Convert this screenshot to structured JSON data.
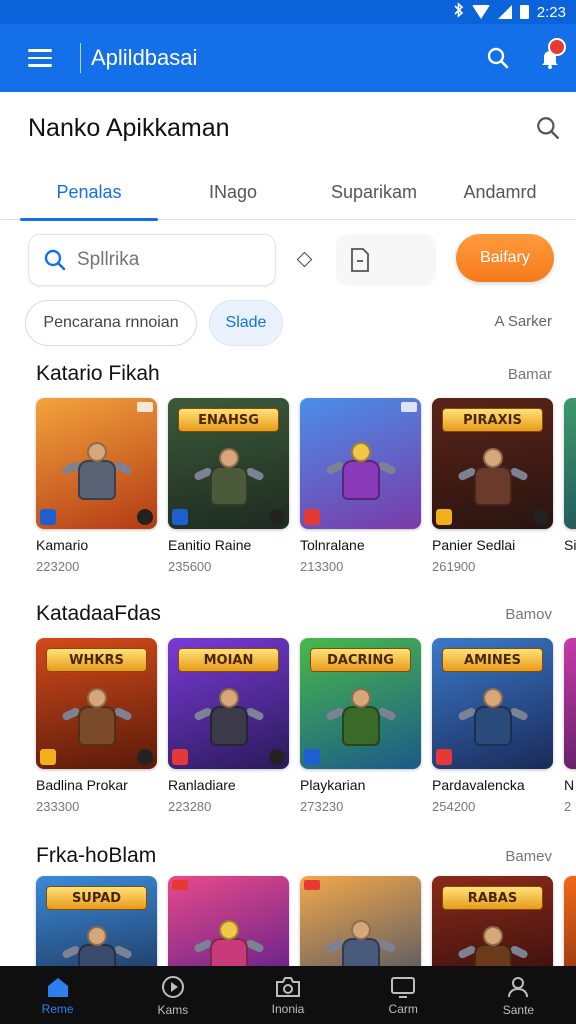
{
  "status_bar": {
    "time": "2:23"
  },
  "app_bar": {
    "title": "Aplildbasai"
  },
  "page": {
    "title": "Nanko Apikkaman"
  },
  "tabs": [
    {
      "label": "Penalas",
      "active": true
    },
    {
      "label": "INago",
      "active": false
    },
    {
      "label": "Suparikam",
      "active": false
    },
    {
      "label": "Andamrd",
      "active": false
    }
  ],
  "search": {
    "placeholder": "Spllrika"
  },
  "filter_button": {
    "label": "Baifary"
  },
  "chips": [
    {
      "label": "Pencarana rnnoian"
    },
    {
      "label": "Slade"
    }
  ],
  "sort_label": "A Sarker",
  "sections": [
    {
      "title": "Katario Fikah",
      "link": "Bamar",
      "items": [
        {
          "name": "Kamario",
          "count": "223200",
          "logo": ""
        },
        {
          "name": "Eanitio Rainе",
          "count": "235600",
          "logo": "ENAHSG"
        },
        {
          "name": "Tolnralane",
          "count": "213300",
          "logo": ""
        },
        {
          "name": "Panier Sedlai",
          "count": "261900",
          "logo": "PIRAXIS"
        },
        {
          "name": "Si",
          "count": "",
          "logo": ""
        }
      ]
    },
    {
      "title": "KatadaaFdas",
      "link": "Bamov",
      "items": [
        {
          "name": "Badlina Prokar",
          "count": "233300",
          "logo": "WHKRS"
        },
        {
          "name": "Ranladiare",
          "count": "223280",
          "logo": "MOIAN"
        },
        {
          "name": "Playkarian",
          "count": "273230",
          "logo": "DACRING"
        },
        {
          "name": "Pardavalencka",
          "count": "254200",
          "logo": "AMINES"
        },
        {
          "name": "N",
          "count": "2",
          "logo": ""
        }
      ]
    },
    {
      "title": "Frka-hoBlam",
      "link": "Bamev",
      "items": [
        {
          "name": "",
          "count": "",
          "logo": "SUPAD"
        },
        {
          "name": "",
          "count": "",
          "logo": ""
        },
        {
          "name": "",
          "count": "",
          "logo": ""
        },
        {
          "name": "",
          "count": "",
          "logo": "RABAS"
        },
        {
          "name": "",
          "count": "",
          "logo": ""
        }
      ]
    }
  ],
  "bottom_nav": [
    {
      "label": "Reme",
      "icon": "home-icon",
      "active": true
    },
    {
      "label": "Kams",
      "icon": "play-circle-icon",
      "active": false
    },
    {
      "label": "Inonia",
      "icon": "camera-icon",
      "active": false
    },
    {
      "label": "Carm",
      "icon": "monitor-icon",
      "active": false
    },
    {
      "label": "Sante",
      "icon": "profile-icon",
      "active": false
    }
  ],
  "colors": {
    "primary": "#1470e8",
    "accent": "#f57a1c",
    "nav_bg": "#0f0f0f"
  }
}
